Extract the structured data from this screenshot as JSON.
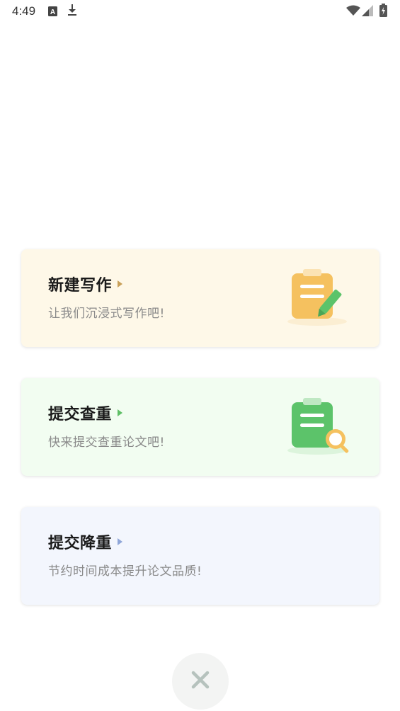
{
  "status_bar": {
    "time": "4:49",
    "icons": [
      "font-notification-icon",
      "download-icon",
      "wifi-icon",
      "signal-icon",
      "battery-icon"
    ]
  },
  "cards": [
    {
      "title": "新建写作",
      "subtitle": "让我们沉浸式写作吧!",
      "background": "#fef8e8",
      "arrow_color": "#c9a15a",
      "icon": "clipboard-pencil-icon",
      "accent": "#f5c15f"
    },
    {
      "title": "提交查重",
      "subtitle": "快来提交查重论文吧!",
      "background": "#f2fdf1",
      "arrow_color": "#5fbf66",
      "icon": "clipboard-magnifier-icon",
      "accent": "#5cc36a"
    },
    {
      "title": "提交降重",
      "subtitle": "节约时间成本提升论文品质!",
      "background": "#f3f6fd",
      "arrow_color": "#8fa6d8",
      "icon": "",
      "accent": "#8fa6d8"
    }
  ],
  "close_button": {
    "icon": "close-icon",
    "color": "#b6c2bd",
    "background": "#f3f4f3"
  }
}
